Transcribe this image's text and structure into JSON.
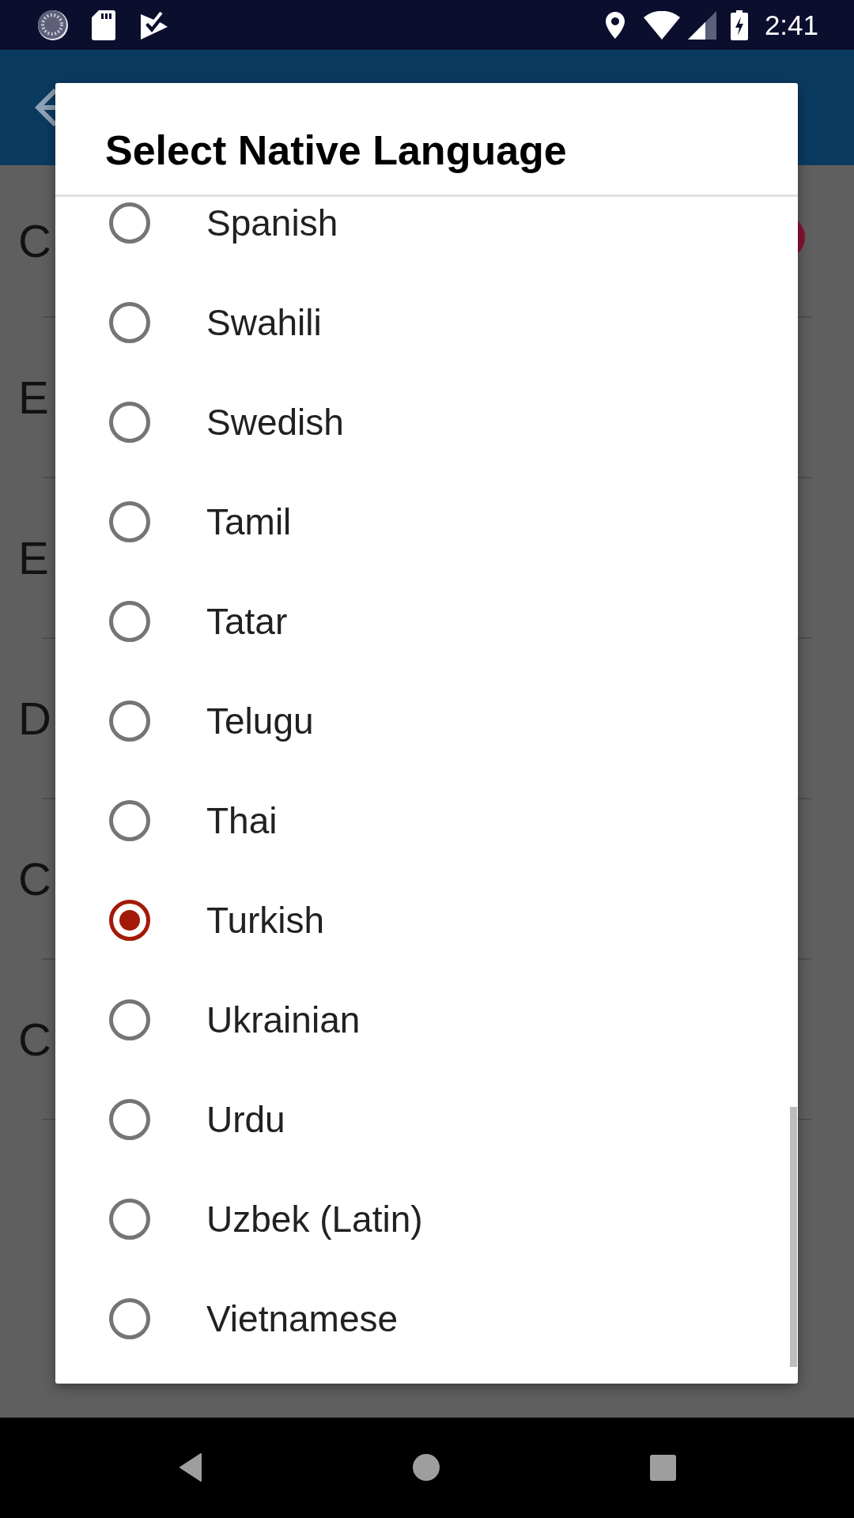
{
  "status_bar": {
    "time": "2:41"
  },
  "background_list": {
    "rows": [
      {
        "text": "C",
        "badge": true
      },
      {
        "text": "E",
        "badge": false
      },
      {
        "text": "E",
        "badge": false
      },
      {
        "text": "D",
        "badge": false
      },
      {
        "text": "C",
        "badge": false
      },
      {
        "text": "C",
        "badge": false
      }
    ]
  },
  "dialog": {
    "title": "Select Native Language",
    "options": [
      {
        "label": "Spanish",
        "selected": false
      },
      {
        "label": "Swahili",
        "selected": false
      },
      {
        "label": "Swedish",
        "selected": false
      },
      {
        "label": "Tamil",
        "selected": false
      },
      {
        "label": "Tatar",
        "selected": false
      },
      {
        "label": "Telugu",
        "selected": false
      },
      {
        "label": "Thai",
        "selected": false
      },
      {
        "label": "Turkish",
        "selected": true
      },
      {
        "label": "Ukrainian",
        "selected": false
      },
      {
        "label": "Urdu",
        "selected": false
      },
      {
        "label": "Uzbek (Latin)",
        "selected": false
      },
      {
        "label": "Vietnamese",
        "selected": false
      }
    ]
  }
}
